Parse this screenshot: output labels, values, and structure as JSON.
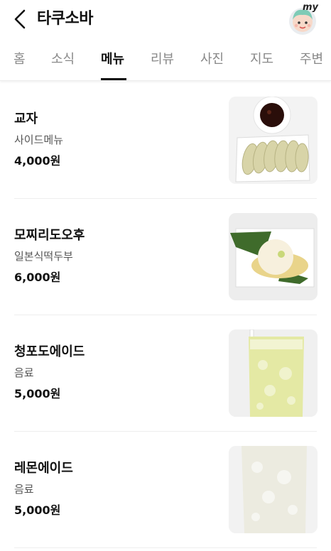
{
  "header": {
    "title": "타쿠소바",
    "back_icon": "chevron-left-icon",
    "profile_label": "my"
  },
  "tabs": [
    {
      "label": "홈",
      "active": false
    },
    {
      "label": "소식",
      "active": false
    },
    {
      "label": "메뉴",
      "active": true
    },
    {
      "label": "리뷰",
      "active": false
    },
    {
      "label": "사진",
      "active": false
    },
    {
      "label": "지도",
      "active": false
    },
    {
      "label": "주변",
      "active": false
    }
  ],
  "menu": [
    {
      "name": "교자",
      "desc": "사이드메뉴",
      "price": "4,000원",
      "image": "dumpling-photo"
    },
    {
      "name": "모찌리도오후",
      "desc": "일본식떡두부",
      "price": "6,000원",
      "image": "mochi-tofu-photo"
    },
    {
      "name": "청포도에이드",
      "desc": "음료",
      "price": "5,000원",
      "image": "green-grape-ade-photo"
    },
    {
      "name": "레몬에이드",
      "desc": "음료",
      "price": "5,000원",
      "image": "lemonade-photo"
    }
  ],
  "colors": {
    "text": "#111111",
    "inactive_tab": "#888888",
    "thumb_bg": "#f2f2f2"
  }
}
